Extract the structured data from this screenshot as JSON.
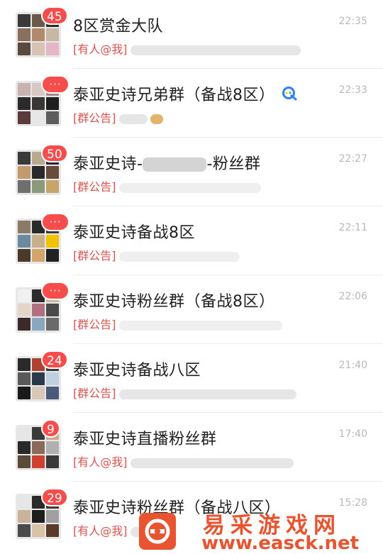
{
  "chats": [
    {
      "title": "8区赏金大队",
      "badge": "45",
      "time": "22:35",
      "tag": "[有人@我]",
      "has_q": false
    },
    {
      "title": "泰亚史诗兄弟群（备战8区）",
      "badge": "···",
      "time": "22:33",
      "tag": "[群公告]",
      "has_q": true
    },
    {
      "title": "泰亚史诗-",
      "title_suffix": "-粉丝群",
      "badge": "50",
      "time": "22:27",
      "tag": "[群公告]",
      "has_q": false
    },
    {
      "title": "泰亚史诗备战8区",
      "badge": "···",
      "time": "22:11",
      "tag": "[群公告]",
      "has_q": false
    },
    {
      "title": "泰亚史诗粉丝群（备战8区）",
      "badge": "···",
      "time": "22:06",
      "tag": "[群公告]",
      "has_q": false
    },
    {
      "title": "泰亚史诗备战八区",
      "badge": "24",
      "time": "21:40",
      "tag": "[群公告]",
      "has_q": false
    },
    {
      "title": "泰亚史诗直播粉丝群",
      "badge": "9",
      "time": "17:40",
      "tag": "[有人@我]",
      "has_q": false
    },
    {
      "title": "泰亚史诗粉丝群（备战八区）",
      "badge": "29",
      "time": "15:28",
      "tag": "[有人@我]",
      "has_q": false
    }
  ],
  "watermark": {
    "name": "易采游戏网",
    "url": "www.easck.net"
  },
  "colors": {
    "badge": "#f74c4c",
    "tag": "#d9534f",
    "brand": "#e8542f"
  }
}
